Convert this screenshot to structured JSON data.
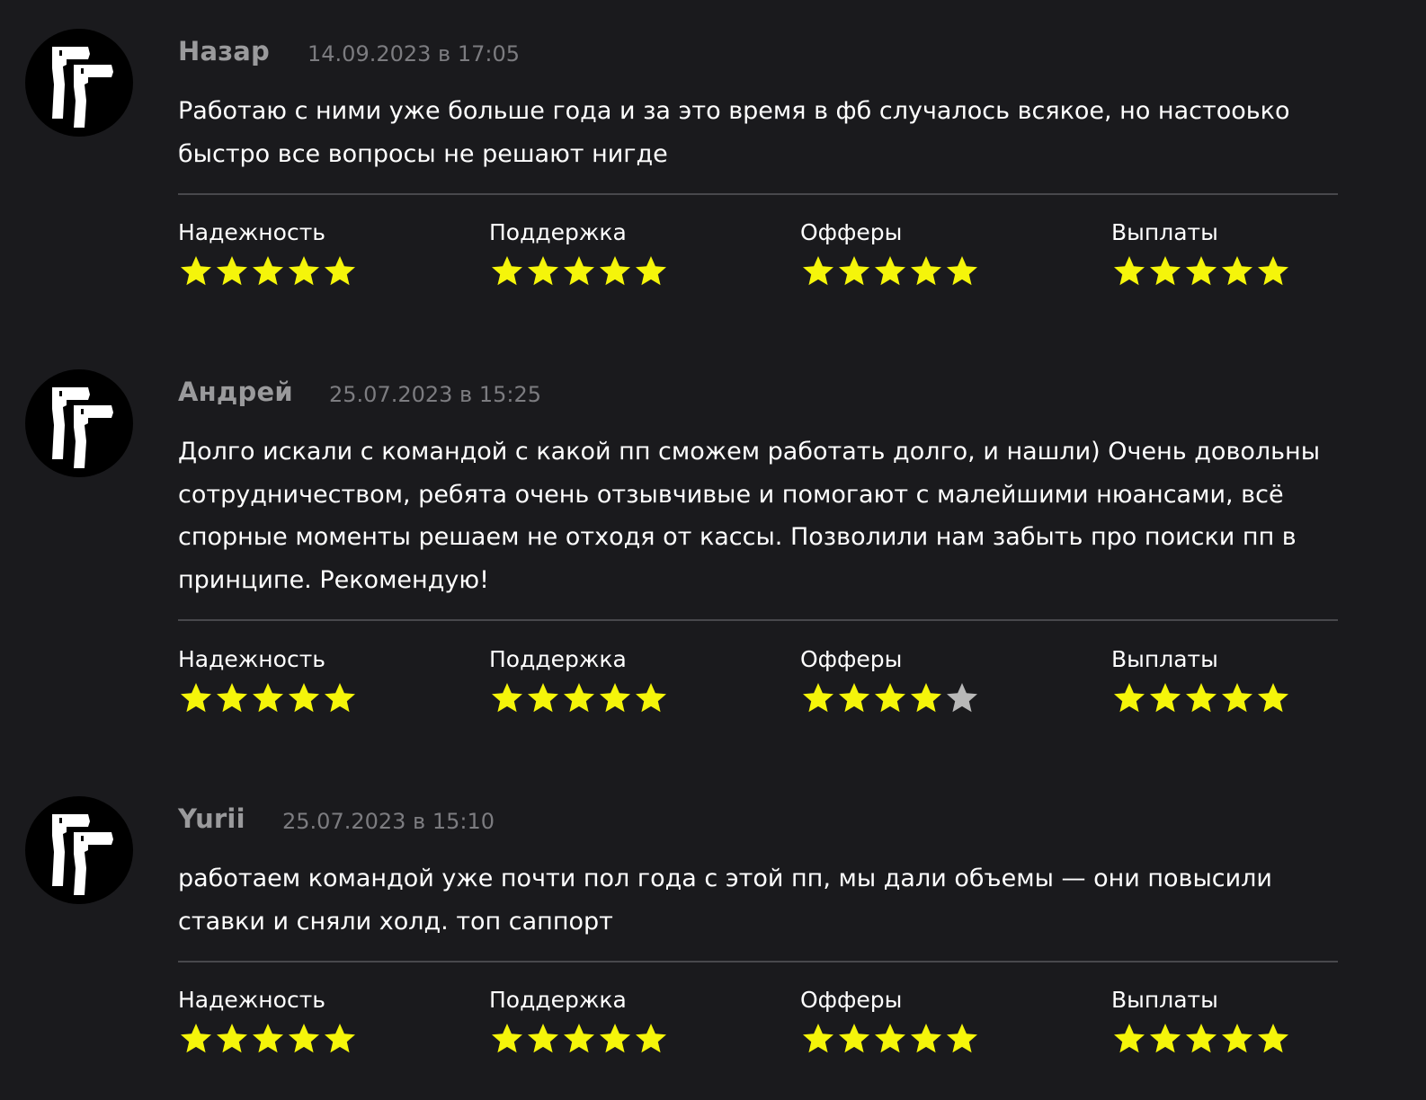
{
  "colors": {
    "background": "#1a1a1d",
    "author": "#9a9a9c",
    "date": "#7c7c80",
    "star_filled": "#f5f50a",
    "star_empty": "#b8b8b8",
    "divider": "#48484c"
  },
  "icons": {
    "avatar": "pistols-logo-icon",
    "rating": "star-icon"
  },
  "reviews": [
    {
      "author": "Назар",
      "date": "14.09.2023 в 17:05",
      "text": "Работаю с ними уже больше года и за это время в фб случалось всякое, но настооько быстро все вопросы не решают нигде",
      "ratings": [
        {
          "label": "Надежность",
          "value": 5,
          "max": 5
        },
        {
          "label": "Поддержка",
          "value": 5,
          "max": 5
        },
        {
          "label": "Офферы",
          "value": 5,
          "max": 5
        },
        {
          "label": "Выплаты",
          "value": 5,
          "max": 5
        }
      ]
    },
    {
      "author": "Андрей",
      "date": "25.07.2023 в 15:25",
      "text": "Долго искали с командой с какой пп сможем работать долго, и нашли) Очень довольны сотрудничеством, ребята очень отзывчивые и помогают с малейшими нюансами, всё спорные моменты решаем не отходя от кассы. Позволили нам забыть про поиски пп в принципе. Рекомендую!",
      "ratings": [
        {
          "label": "Надежность",
          "value": 5,
          "max": 5
        },
        {
          "label": "Поддержка",
          "value": 5,
          "max": 5
        },
        {
          "label": "Офферы",
          "value": 4,
          "max": 5
        },
        {
          "label": "Выплаты",
          "value": 5,
          "max": 5
        }
      ]
    },
    {
      "author": "Yurii",
      "date": "25.07.2023 в 15:10",
      "text": "работаем командой уже почти пол года с этой пп, мы дали объемы — они повысили ставки и сняли холд. топ саппорт",
      "ratings": [
        {
          "label": "Надежность",
          "value": 5,
          "max": 5
        },
        {
          "label": "Поддержка",
          "value": 5,
          "max": 5
        },
        {
          "label": "Офферы",
          "value": 5,
          "max": 5
        },
        {
          "label": "Выплаты",
          "value": 5,
          "max": 5
        }
      ]
    }
  ]
}
